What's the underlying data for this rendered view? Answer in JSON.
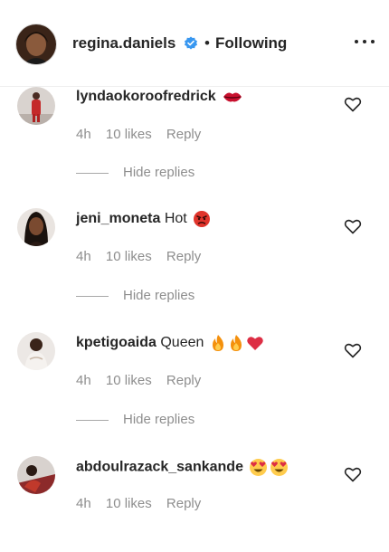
{
  "header": {
    "username": "regina.daniels",
    "separator": "•",
    "follow_status": "Following",
    "avatar_icon": "profile-photo",
    "verified_icon": "verified-badge-icon",
    "more_icon": "more-options-icon"
  },
  "comments": [
    {
      "username": "lyndaokoroofredrick",
      "text": "",
      "emojis": [
        "lips-emoji"
      ],
      "time": "4h",
      "likes": "10 likes",
      "reply": "Reply",
      "hide_replies": "Hide replies"
    },
    {
      "username": "jeni_moneta",
      "text": "Hot",
      "emojis": [
        "angry-face-emoji"
      ],
      "time": "4h",
      "likes": "10 likes",
      "reply": "Reply",
      "hide_replies": "Hide replies"
    },
    {
      "username": "kpetigoaida",
      "text": "Queen",
      "emojis": [
        "fire-emoji",
        "fire-emoji",
        "red-heart-emoji"
      ],
      "time": "4h",
      "likes": "10 likes",
      "reply": "Reply",
      "hide_replies": "Hide replies"
    },
    {
      "username": "abdoulrazack_sankande",
      "text": "",
      "emojis": [
        "heart-eyes-emoji",
        "heart-eyes-emoji"
      ],
      "time": "4h",
      "likes": "10 likes",
      "reply": "Reply"
    }
  ],
  "colors": {
    "text": "#262626",
    "muted": "#8e8e8e",
    "verified": "#3897f0",
    "divider": "#efefef"
  }
}
